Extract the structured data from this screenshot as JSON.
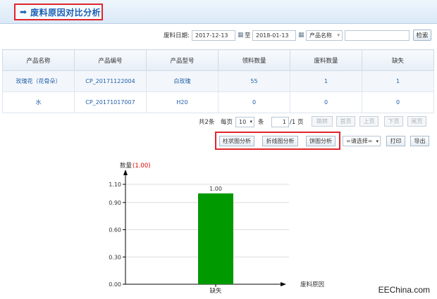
{
  "header": {
    "title": "废料原因对比分析"
  },
  "filter": {
    "date_label": "废料日期:",
    "date_from": "2017-12-13",
    "to_label": "至",
    "date_to": "2018-01-13",
    "field_select": "产品名称",
    "search_value": "",
    "search_label": "检索"
  },
  "table": {
    "columns": [
      "产品名称",
      "产品编号",
      "产品型号",
      "领料数量",
      "废料数量",
      "缺失"
    ],
    "rows": [
      [
        "玫瑰花（花骨朵）",
        "CP_20171122004",
        "白玫瑰",
        "55",
        "1",
        "1"
      ],
      [
        "水",
        "CP_20171017007",
        "H20",
        "0",
        "0",
        "0"
      ]
    ]
  },
  "pager": {
    "total": "共2条",
    "per_page_label": "每页",
    "per_page": "10",
    "unit": "条",
    "page": "1",
    "page_total": "/1 页",
    "jump": "跳转",
    "first": "首页",
    "prev": "上页",
    "next": "下页",
    "last": "尾页"
  },
  "analysis": {
    "bar_button": "柱状图分析",
    "line_button": "折线图分析",
    "pie_button": "饼图分析",
    "select": "=请选择=",
    "print": "打印",
    "export": "导出"
  },
  "chart_data": {
    "type": "bar",
    "categories": [
      "缺失"
    ],
    "values": [
      1.0
    ],
    "value_labels": [
      "1.00"
    ],
    "ylabel": "数量",
    "ylabel_value": "(1.00)",
    "xlabel": "废料原因",
    "yticks": [
      "0.00",
      "0.30",
      "0.60",
      "0.90",
      "1.10"
    ],
    "ylim": [
      0,
      1.1
    ],
    "bar_color": "#009900",
    "grid": true
  },
  "watermark": "EEChina.com"
}
